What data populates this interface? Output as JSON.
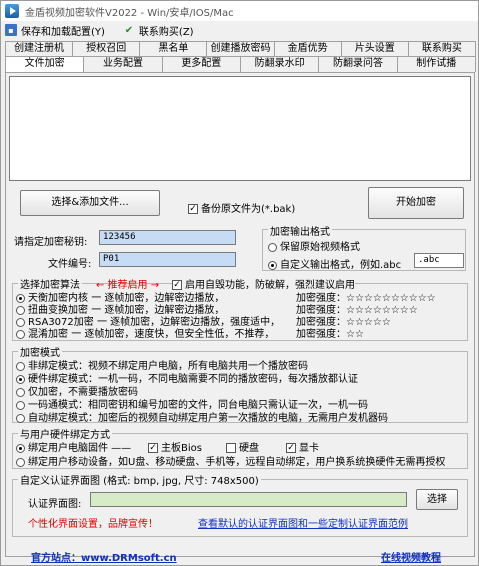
{
  "window": {
    "title": "金盾视频加密软件V2022 - Win/安卓/IOS/Mac"
  },
  "menu": {
    "save_load": "保存和加载配置(Y)",
    "contact": "联系购买(Z)"
  },
  "tabs_row1": [
    "创建注册机",
    "授权召回",
    "黑名单",
    "创建播放密码",
    "金盾优势",
    "片头设置",
    "联系购买"
  ],
  "tabs_row2": [
    "文件加密",
    "业务配置",
    "更多配置",
    "防翻录水印",
    "防翻录问答",
    "制作试播"
  ],
  "active_tab": "文件加密",
  "buttons": {
    "select_add": "选择&添加文件...",
    "start": "开始加密",
    "choose": "选择"
  },
  "backup": {
    "label": "备份原文件为(*.bak)",
    "checked": true
  },
  "password": {
    "label": "请指定加密秘钥:",
    "value": "123456"
  },
  "file_number": {
    "label": "文件编号:",
    "value": "P01"
  },
  "output_format": {
    "title": "加密输出格式",
    "keep": "保留原始视频格式",
    "custom": "自定义输出格式，例如.abc",
    "custom_value": ".abc"
  },
  "algo": {
    "title": "选择加密算法",
    "recommend": "← 推荐启用 →",
    "anti_crack": "启用自毁功能，防破解，强烈建议启用",
    "items": [
      {
        "name": "天衡加密内核",
        "desc": "一 逐帧加密，边解密边播放，",
        "strength_label": "加密强度：",
        "stars": "☆☆☆☆☆☆☆☆☆☆"
      },
      {
        "name": "扭曲变换加密",
        "desc": "一 逐帧加密，边解密边播放，",
        "strength_label": "加密强度：",
        "stars": "☆☆☆☆☆☆☆☆"
      },
      {
        "name": "RSA3072加密",
        "desc": "一 逐帧加密，边解密边播放，强度适中，",
        "strength_label": "加密强度：",
        "stars": "☆☆☆☆☆"
      },
      {
        "name": "混淆加密",
        "desc": "一 逐帧加密，速度快，但安全性低，不推荐，",
        "strength_label": "加密强度：",
        "stars": "☆☆"
      }
    ]
  },
  "mode": {
    "title": "加密模式",
    "items": [
      "非绑定模式：视频不绑定用户电脑，所有电脑共用一个播放密码",
      "硬件绑定模式：一机一码，不同电脑需要不同的播放密码，每次播放都认证",
      "仅加密，不需要播放密码",
      "一码通模式：相同密钥和编号加密的文件，同台电脑只需认证一次，一机一码",
      "自动绑定模式：加密后的视频自动绑定用户第一次播放的电脑，无需用户发机器码"
    ]
  },
  "hw": {
    "title": "与用户硬件绑定方式",
    "bind_pc": "绑定用户电脑固件 ——",
    "mainboard": "主板Bios",
    "disk": "硬盘",
    "gpu": "显卡",
    "bind_mobile": "绑定用户移动设备，如U盘、移动硬盘、手机等，远程自动绑定，用户换系统换硬件无需再授权"
  },
  "auth_ui": {
    "title": "自定义认证界面图 (格式: bmp, jpg, 尺寸: 748x500)",
    "label": "认证界面图:",
    "personalize": "个性化界面设置，品牌宣传！",
    "view_link": "查看默认的认证界面图和一些定制认证界面范例"
  },
  "status": {
    "site": "官方站点：www.DRMsoft.cn",
    "tutorial": "在线视频教程"
  }
}
